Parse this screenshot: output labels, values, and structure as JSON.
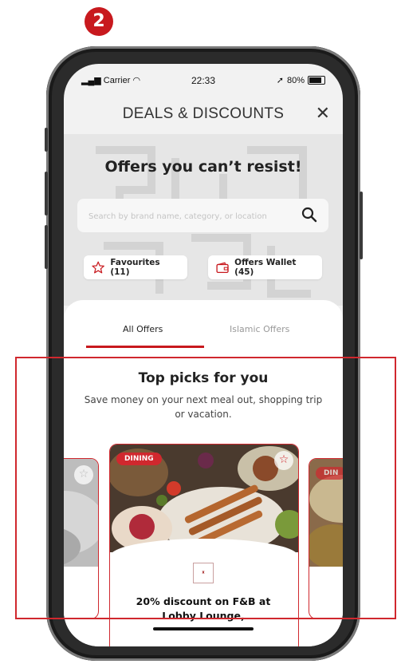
{
  "step_badge": "2",
  "status_bar": {
    "carrier": "Carrier",
    "time": "22:33",
    "battery": "80%"
  },
  "header": {
    "title": "DEALS & DISCOUNTS",
    "close_label": "✕"
  },
  "hero": {
    "title": "Offers you can’t resist!",
    "search_placeholder": "Search by brand name, category, or location"
  },
  "pills": {
    "favourites": "Favourites (11)",
    "wallet": "Offers Wallet (45)"
  },
  "tabs": [
    {
      "label": "All Offers",
      "active": true
    },
    {
      "label": "Islamic Offers",
      "active": false
    }
  ],
  "section": {
    "title": "Top picks for you",
    "subtitle": "Save money on your next meal out, shopping trip or vacation."
  },
  "cards": {
    "main": {
      "tag": "DINING",
      "title": "20% discount on F&B at Lobby Lounge,"
    },
    "right_peek": {
      "tag": "DIN"
    }
  },
  "colors": {
    "accent": "#c8191e",
    "screen_bg": "#f2f2f2",
    "hero_bg": "#e6e6e6"
  }
}
